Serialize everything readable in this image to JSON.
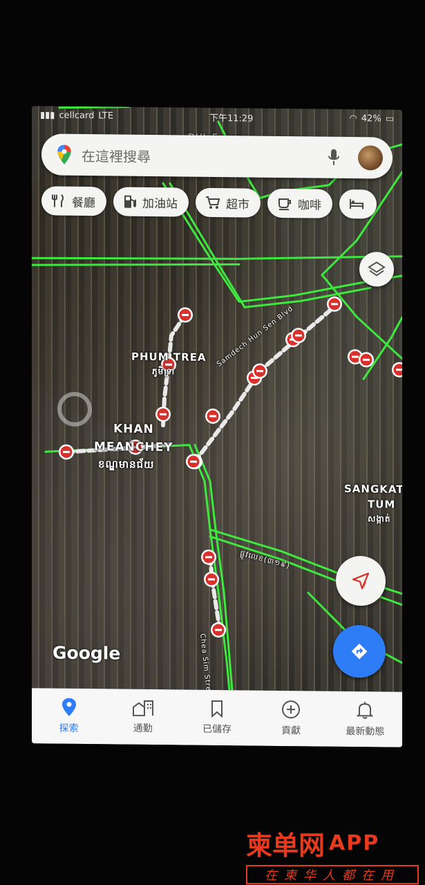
{
  "status_bar": {
    "carrier": "cellcard",
    "network": "LTE",
    "time": "下午11:29",
    "battery": "42%"
  },
  "search": {
    "placeholder": "在這裡搜尋",
    "pin_icon": "google-maps-pin-icon",
    "mic_icon": "mic-icon",
    "avatar_icon": "user-avatar"
  },
  "chips": [
    {
      "label": "餐廳",
      "icon": "restaurant-icon"
    },
    {
      "label": "加油站",
      "icon": "gas-station-icon"
    },
    {
      "label": "超市",
      "icon": "cart-icon"
    },
    {
      "label": "咖啡",
      "icon": "coffee-icon"
    },
    {
      "label": "",
      "icon": "hotel-icon"
    }
  ],
  "map": {
    "labels": {
      "poi_top": "DHL Express",
      "phum_trea": "PHUM TREA",
      "phum_trea_khmer": "ភូមិទ្រា",
      "khan_line1": "KHAN",
      "khan_line2": "MEANCHEY",
      "khan_khmer": "ខណ្ឌមានជ័យ",
      "sangkat_line1": "SANGKAT",
      "sangkat_line2": "TUM",
      "sangkat_khmer": "សង្កាត់",
      "street_samdech": "Samdech Hun Sen Blvd",
      "street_khmer": "ផ្លូវលេខ(៣១៩)",
      "street_chea": "Chea Sim Street"
    },
    "traffic_color": "#3ee83e",
    "closure_color": "#d8302b",
    "google_logo": "Google"
  },
  "fabs": {
    "layers_icon": "layers-icon",
    "locate_icon": "location-arrow-icon",
    "directions_icon": "directions-icon"
  },
  "bottom_nav": [
    {
      "label": "探索",
      "icon": "explore-pin-icon",
      "active": true
    },
    {
      "label": "通勤",
      "icon": "commute-icon",
      "active": false
    },
    {
      "label": "已儲存",
      "icon": "bookmark-icon",
      "active": false
    },
    {
      "label": "貢獻",
      "icon": "add-circle-icon",
      "active": false
    },
    {
      "label": "最新動態",
      "icon": "bell-icon",
      "active": false
    }
  ],
  "watermark": {
    "title": "柬单网",
    "app": "APP",
    "subtitle": "在柬华人都在用"
  }
}
